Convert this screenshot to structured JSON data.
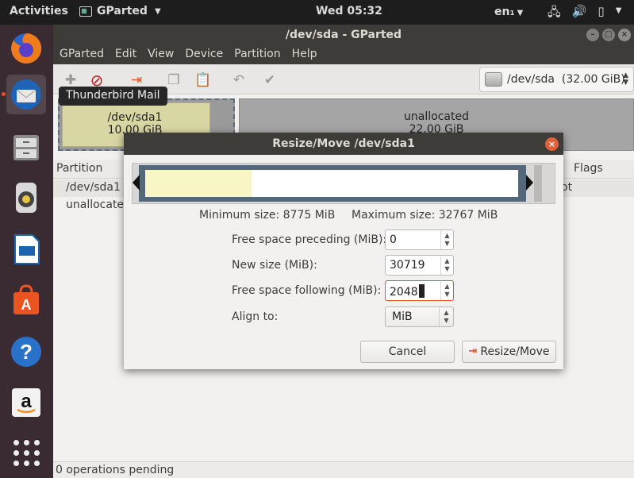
{
  "topbar": {
    "activities": "Activities",
    "app_name": "GParted",
    "clock": "Wed 05:32",
    "language": "en₁"
  },
  "window": {
    "title": "/dev/sda - GParted",
    "menu": [
      "GParted",
      "Edit",
      "View",
      "Device",
      "Partition",
      "Help"
    ],
    "device_selector": "/dev/sda  (32.00 GiB)",
    "tooltip": "Thunderbird Mail",
    "graph": {
      "part1_name": "/dev/sda1",
      "part1_size": "10.00 GiB",
      "part2_name": "unallocated",
      "part2_size": "22.00 GiB"
    },
    "list": {
      "col_partition": "Partition",
      "col_flags": "Flags",
      "rows": [
        {
          "partition": "/dev/sda1",
          "flags": "ot"
        },
        {
          "partition": "unallocated",
          "flags": ""
        }
      ]
    },
    "status": "0 operations pending"
  },
  "dialog": {
    "title": "Resize/Move /dev/sda1",
    "min_size": "Minimum size: 8775 MiB",
    "max_size": "Maximum size: 32767 MiB",
    "free_preceding_label": "Free space preceding (MiB):",
    "free_preceding_value": "0",
    "new_size_label": "New size (MiB):",
    "new_size_value": "30719",
    "free_following_label": "Free space following (MiB):",
    "free_following_value": "2048",
    "align_label": "Align to:",
    "align_value": "MiB",
    "cancel_label": "Cancel",
    "apply_label": "Resize/Move"
  },
  "colors": {
    "accent": "#e95420",
    "dock": "#3a2b33",
    "titlebar": "#3d3c38"
  }
}
